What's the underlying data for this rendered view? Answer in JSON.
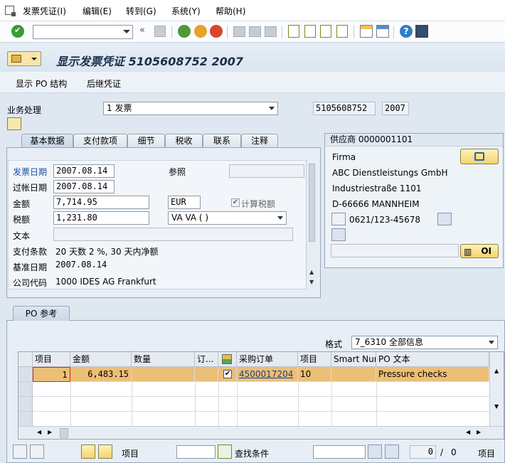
{
  "menu": {
    "items": [
      "发票凭证(I)",
      "编辑(E)",
      "转到(G)",
      "系统(Y)",
      "帮助(H)"
    ]
  },
  "toolbar": {
    "command_value": "",
    "back_symbol": "«"
  },
  "title": {
    "text": "显示发票凭证 5105608752 2007"
  },
  "app_toolbar": {
    "show_po_structure": "显示 PO 结构",
    "follow_on_docs": "后继凭证"
  },
  "header": {
    "transaction_label": "业务处理",
    "transaction_value": "1 发票",
    "doc_number": "5105608752",
    "fiscal_year": "2007"
  },
  "tabs": [
    "基本数据",
    "支付款项",
    "细节",
    "税收",
    "联系",
    "注释"
  ],
  "basic": {
    "invoice_date_label": "发票日期",
    "invoice_date": "2007.08.14",
    "reference_label": "参照",
    "reference": "",
    "posting_date_label": "过帐日期",
    "posting_date": "2007.08.14",
    "amount_label": "金额",
    "amount": "7,714.95",
    "currency": "EUR",
    "calc_tax_label": "计算税额",
    "tax_label": "税额",
    "tax_amount": "1,231.80",
    "tax_code": "VA VA ( )",
    "text_label": "文本",
    "text": "",
    "payment_terms_label": "支付条款",
    "payment_terms": "20 天数 2 %, 30 天内净额",
    "baseline_label": "基准日期",
    "baseline_date": "2007.08.14",
    "company_label": "公司代码",
    "company": "1000 IDES AG Frankfurt"
  },
  "vendor": {
    "header": "供应商 0000001101",
    "firma": "Firma",
    "name": "ABC Dienstleistungs GmbH",
    "street": "Industriestraße 1101",
    "city": "D-66666 MANNHEIM",
    "phone": "0621/123-45678",
    "bank_field": "",
    "oi_label": "OI"
  },
  "po": {
    "tab_label": "PO 参考",
    "layout_label": "格式",
    "layout_value": "7_6310 全部信息",
    "columns": [
      "项目",
      "金额",
      "数量",
      "订...",
      "",
      "采购订单",
      "项目",
      "Smart Num",
      "PO 文本"
    ],
    "rows": [
      {
        "item": "1",
        "amount": "6,483.15",
        "qty": "",
        "order_unit": "",
        "checked": "✔",
        "po_number": "4500017204",
        "po_item": "10",
        "smart_num": "",
        "po_text": "Pressure checks"
      }
    ]
  },
  "bottom": {
    "item_label": "项目",
    "item_value": "",
    "search_label": "查找条件",
    "search_value": "",
    "page_current": "0",
    "page_sep": "/",
    "page_total": "0",
    "right_label": "项目"
  },
  "colors": {
    "accent": "#1b4fa3",
    "selected_row": "#ecbf77",
    "panel": "#e7eef6"
  }
}
